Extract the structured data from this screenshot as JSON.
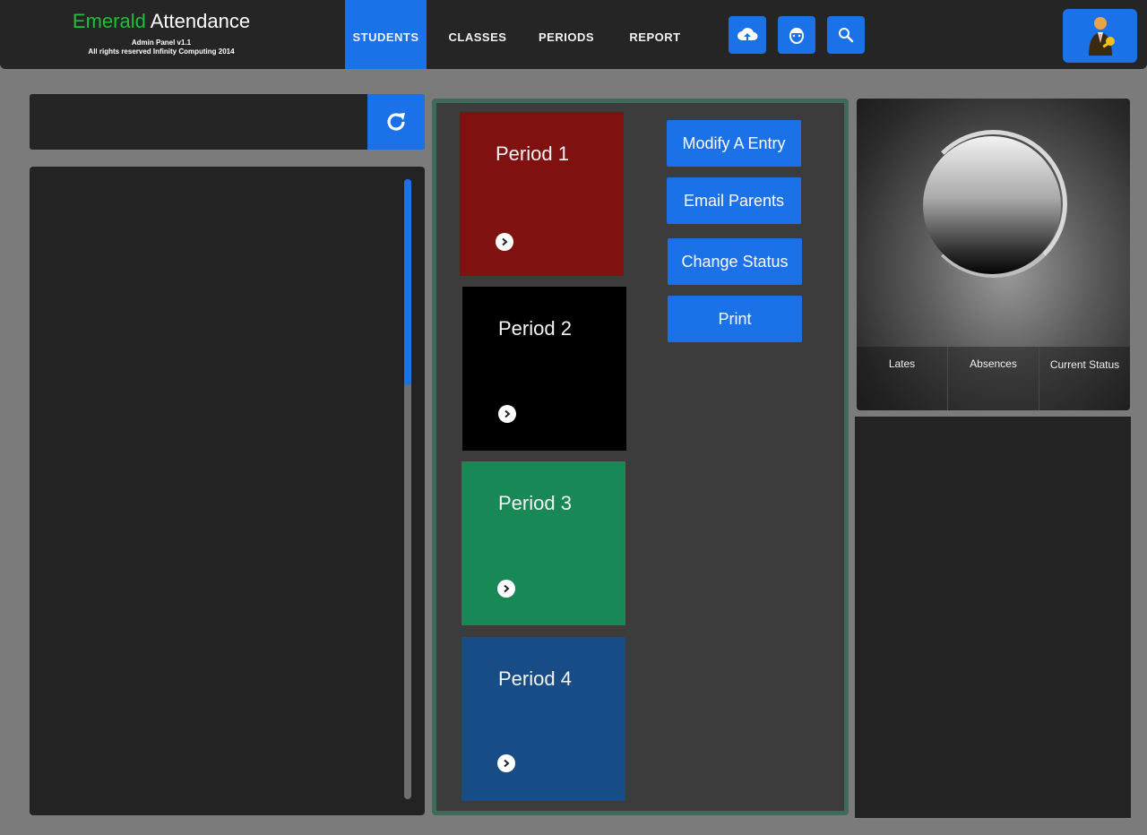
{
  "app": {
    "title_accent": "Emerald",
    "title_rest": " Attendance",
    "subtitle": "Admin Panel v1.1",
    "copyright": "All rights reserved Infinity Computing 2014"
  },
  "nav": {
    "tabs": [
      {
        "label": "STUDENTS",
        "active": true
      },
      {
        "label": "CLASSES",
        "active": false
      },
      {
        "label": "PERIODS",
        "active": false
      },
      {
        "label": "REPORT",
        "active": false
      }
    ]
  },
  "toolbar": {
    "icons": [
      "cloud-upload-icon",
      "face-icon",
      "search-icon"
    ],
    "user_icon": "admin-user-icon"
  },
  "search": {
    "value": "",
    "placeholder": "",
    "refresh_icon": "refresh-icon"
  },
  "periods": [
    {
      "label": "Period 1",
      "color": "#7f1111"
    },
    {
      "label": "Period 2",
      "color": "#000000"
    },
    {
      "label": "Period 3",
      "color": "#188856"
    },
    {
      "label": "Period 4",
      "color": "#174c86"
    }
  ],
  "actions": {
    "modify": "Modify  A Entry",
    "email": "Email Parents",
    "status": "Change Status",
    "print": "Print"
  },
  "profile": {
    "stats": [
      "Lates",
      "Absences",
      "Current Status"
    ]
  },
  "colors": {
    "accent": "#1b71e8",
    "brand_green": "#1fbf3a",
    "panel_border": "#3f6b5a"
  }
}
